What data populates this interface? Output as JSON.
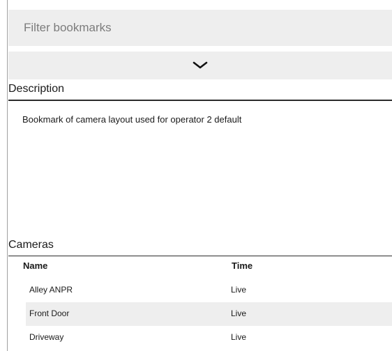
{
  "filter": {
    "placeholder": "Filter bookmarks"
  },
  "collapse": {
    "icon": "chevron-down-icon"
  },
  "description": {
    "title": "Description",
    "text": "Bookmark of camera layout used for operator 2 default"
  },
  "cameras": {
    "title": "Cameras",
    "columns": {
      "name": "Name",
      "time": "Time"
    },
    "rows": [
      {
        "name": "Alley ANPR",
        "time": "Live"
      },
      {
        "name": "Front Door",
        "time": "Live"
      },
      {
        "name": "Driveway",
        "time": "Live"
      }
    ]
  },
  "colors": {
    "panel_bg": "#eeeeee",
    "rule": "#2a2a2a",
    "text": "#1a1a1a"
  }
}
